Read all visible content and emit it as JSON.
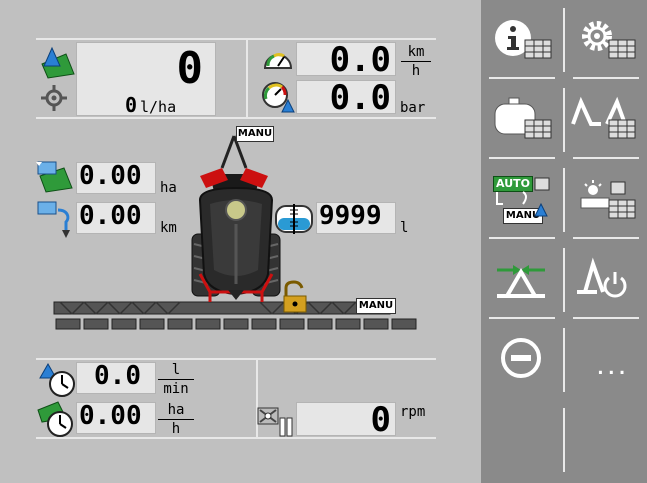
{
  "top": {
    "application_rate_value": "0",
    "application_rate_unit": "l/ha",
    "speed_value": "0.0",
    "speed_unit_top": "km",
    "speed_unit_bottom": "h",
    "pressure_value": "0.0",
    "pressure_unit": "bar"
  },
  "middle": {
    "area_value": "0.00",
    "area_unit": "ha",
    "distance_value": "0.00",
    "distance_unit": "km",
    "tank_value": "9999",
    "tank_unit": "l",
    "mode_top_label": "MANU",
    "mode_boom_label": "MANU"
  },
  "bottom": {
    "flow_value": "0.0",
    "flow_unit_top": "l",
    "flow_unit_bottom": "min",
    "work_rate_value": "0.00",
    "work_rate_unit_top": "ha",
    "work_rate_unit_bottom": "h",
    "pto_value": "0",
    "pto_unit": "rpm"
  },
  "softkeys": {
    "auto_label": "AUTO",
    "manu_label": "MANU",
    "more_label": "..."
  },
  "colors": {
    "background": "#c0c0c0",
    "softkey_panel": "#8a8a8a",
    "field_green": "#3a9a3a",
    "drop_blue": "#2a7fd4",
    "sprayer_red": "#cc1010",
    "lock_gold": "#d4a020"
  }
}
